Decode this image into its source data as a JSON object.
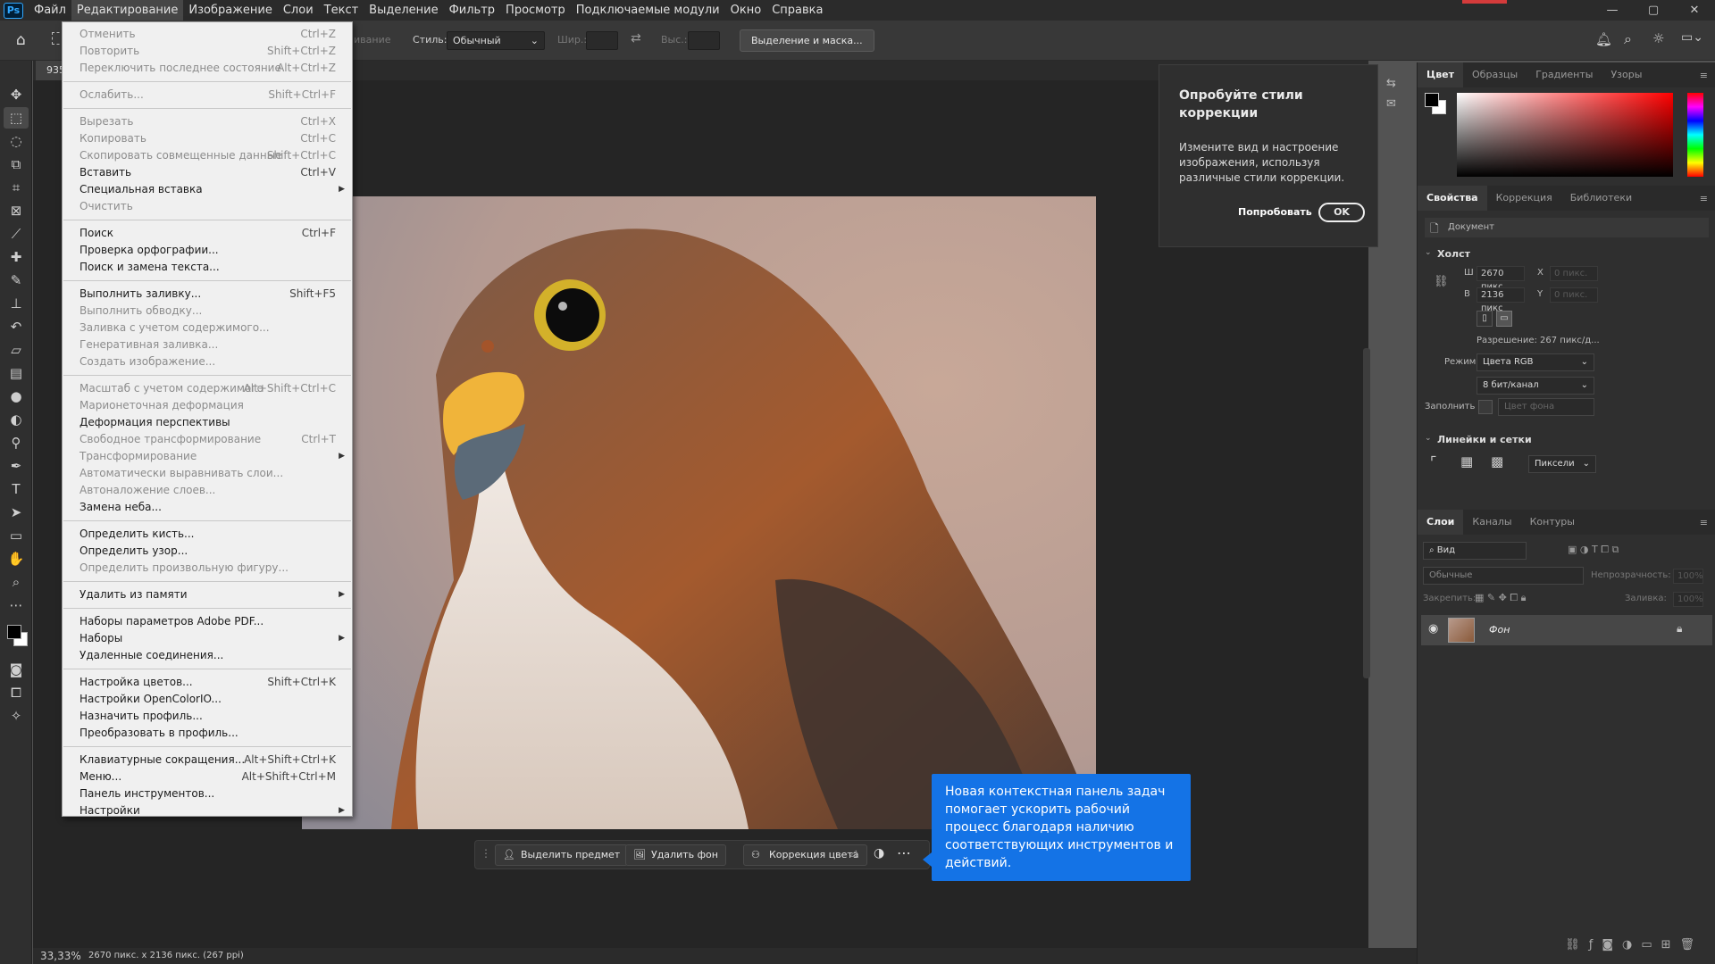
{
  "app": {
    "logo": "Ps"
  },
  "menubar": {
    "items": [
      "Файл",
      "Редактирование",
      "Изображение",
      "Слои",
      "Текст",
      "Выделение",
      "Фильтр",
      "Просмотр",
      "Подключаемые модули",
      "Окно",
      "Справка"
    ],
    "window_buttons": [
      "—",
      "▢",
      "✕"
    ]
  },
  "options": {
    "feather_label": "ивание",
    "style_label": "Стиль:",
    "style_value": "Обычный",
    "width_label": "Шир.:",
    "height_label": "Выс.:",
    "select_mask_button": "Выделение и маска..."
  },
  "document": {
    "tab_label": "935"
  },
  "edit_menu": {
    "items": [
      {
        "label": "Отменить",
        "shortcut": "Ctrl+Z",
        "disabled": true
      },
      {
        "label": "Повторить",
        "shortcut": "Shift+Ctrl+Z",
        "disabled": true
      },
      {
        "label": "Переключить последнее состояние",
        "shortcut": "Alt+Ctrl+Z",
        "disabled": true
      },
      {
        "label": "Ослабить...",
        "shortcut": "Shift+Ctrl+F",
        "disabled": true
      },
      {
        "label": "Вырезать",
        "shortcut": "Ctrl+X",
        "disabled": true
      },
      {
        "label": "Копировать",
        "shortcut": "Ctrl+C",
        "disabled": true
      },
      {
        "label": "Скопировать совмещенные данные",
        "shortcut": "Shift+Ctrl+C",
        "disabled": true
      },
      {
        "label": "Вставить",
        "shortcut": "Ctrl+V",
        "disabled": false
      },
      {
        "label": "Специальная вставка",
        "shortcut": "",
        "disabled": false,
        "submenu": true
      },
      {
        "label": "Очистить",
        "shortcut": "",
        "disabled": true
      },
      {
        "label": "Поиск",
        "shortcut": "Ctrl+F",
        "disabled": false
      },
      {
        "label": "Проверка орфографии...",
        "shortcut": "",
        "disabled": false
      },
      {
        "label": "Поиск и замена текста...",
        "shortcut": "",
        "disabled": false
      },
      {
        "label": "Выполнить заливку...",
        "shortcut": "Shift+F5",
        "disabled": false
      },
      {
        "label": "Выполнить обводку...",
        "shortcut": "",
        "disabled": true
      },
      {
        "label": "Заливка с учетом содержимого...",
        "shortcut": "",
        "disabled": true
      },
      {
        "label": "Генеративная заливка...",
        "shortcut": "",
        "disabled": true
      },
      {
        "label": "Создать изображение...",
        "shortcut": "",
        "disabled": true
      },
      {
        "label": "Масштаб с учетом содержимого",
        "shortcut": "Alt+Shift+Ctrl+C",
        "disabled": true
      },
      {
        "label": "Марионеточная деформация",
        "shortcut": "",
        "disabled": true
      },
      {
        "label": "Деформация перспективы",
        "shortcut": "",
        "disabled": false
      },
      {
        "label": "Свободное трансформирование",
        "shortcut": "Ctrl+T",
        "disabled": true
      },
      {
        "label": "Трансформирование",
        "shortcut": "",
        "disabled": true,
        "submenu": true
      },
      {
        "label": "Автоматически выравнивать слои...",
        "shortcut": "",
        "disabled": true
      },
      {
        "label": "Автоналожение слоев...",
        "shortcut": "",
        "disabled": true
      },
      {
        "label": "Замена неба...",
        "shortcut": "",
        "disabled": false
      },
      {
        "label": "Определить кисть...",
        "shortcut": "",
        "disabled": false
      },
      {
        "label": "Определить узор...",
        "shortcut": "",
        "disabled": false
      },
      {
        "label": "Определить произвольную фигуру...",
        "shortcut": "",
        "disabled": true
      },
      {
        "label": "Удалить из памяти",
        "shortcut": "",
        "disabled": false,
        "submenu": true
      },
      {
        "label": "Наборы параметров Adobe PDF...",
        "shortcut": "",
        "disabled": false
      },
      {
        "label": "Наборы",
        "shortcut": "",
        "disabled": false,
        "submenu": true
      },
      {
        "label": "Удаленные соединения...",
        "shortcut": "",
        "disabled": false
      },
      {
        "label": "Настройка цветов...",
        "shortcut": "Shift+Ctrl+K",
        "disabled": false
      },
      {
        "label": "Настройки OpenColorIO...",
        "shortcut": "",
        "disabled": false
      },
      {
        "label": "Назначить профиль...",
        "shortcut": "",
        "disabled": false
      },
      {
        "label": "Преобразовать в профиль...",
        "shortcut": "",
        "disabled": false
      },
      {
        "label": "Клавиатурные сокращения...",
        "shortcut": "Alt+Shift+Ctrl+K",
        "disabled": false
      },
      {
        "label": "Меню...",
        "shortcut": "Alt+Shift+Ctrl+M",
        "disabled": false
      },
      {
        "label": "Панель инструментов...",
        "shortcut": "",
        "disabled": false
      },
      {
        "label": "Настройки",
        "shortcut": "",
        "disabled": false,
        "submenu": true
      }
    ]
  },
  "try_card": {
    "title": "Опробуйте стили коррекции",
    "body": "Измените вид и настроение изображения, используя различные стили коррекции.",
    "try_button": "Попробовать",
    "ok_button": "OK"
  },
  "color_panel": {
    "tabs": [
      "Цвет",
      "Образцы",
      "Градиенты",
      "Узоры"
    ]
  },
  "properties_panel": {
    "tabs": [
      "Свойства",
      "Коррекция",
      "Библиотеки"
    ],
    "doc_label": "Документ",
    "canvas_section": "Холст",
    "w_label": "Ш",
    "w_value": "2670 пикс",
    "h_label": "В",
    "h_value": "2136 пикс",
    "x_label": "X",
    "x_placeholder": "0 пикс.",
    "y_label": "Y",
    "y_placeholder": "0 пикс.",
    "resolution": "Разрешение: 267 пикс/д...",
    "mode_label": "Режим",
    "mode_value": "Цвета RGB",
    "depth_value": "8 бит/канал",
    "fill_label": "Заполнить",
    "fill_value": "Цвет фона",
    "rulers_section": "Линейки и сетки",
    "units_value": "Пиксели"
  },
  "layers_panel": {
    "tabs": [
      "Слои",
      "Каналы",
      "Контуры"
    ],
    "search_placeholder": "Вид",
    "blend_value": "Обычные",
    "opacity_label": "Непрозрачность:",
    "opacity_value": "100%",
    "lock_label": "Закрепить:",
    "fill_label": "Заливка:",
    "fill_value": "100%",
    "layers": [
      {
        "name": "Фон",
        "visible": true,
        "locked": true
      }
    ]
  },
  "context_bar": {
    "select_subject": "Выделить предмет",
    "remove_bg": "Удалить фон",
    "color_correction": "Коррекция цвета"
  },
  "blue_tooltip": {
    "text": "Новая контекстная панель задач помогает ускорить рабочий процесс благодаря наличию соответствующих инструментов и действий."
  },
  "status": {
    "zoom": "33,33%",
    "info": "2670 пикс. x 2136 пикс. (267 ppi)"
  },
  "colors": {
    "accent_blue": "#1473e6",
    "menu_bg": "#f0f0f0",
    "bar_dark": "#2b2b2b"
  }
}
